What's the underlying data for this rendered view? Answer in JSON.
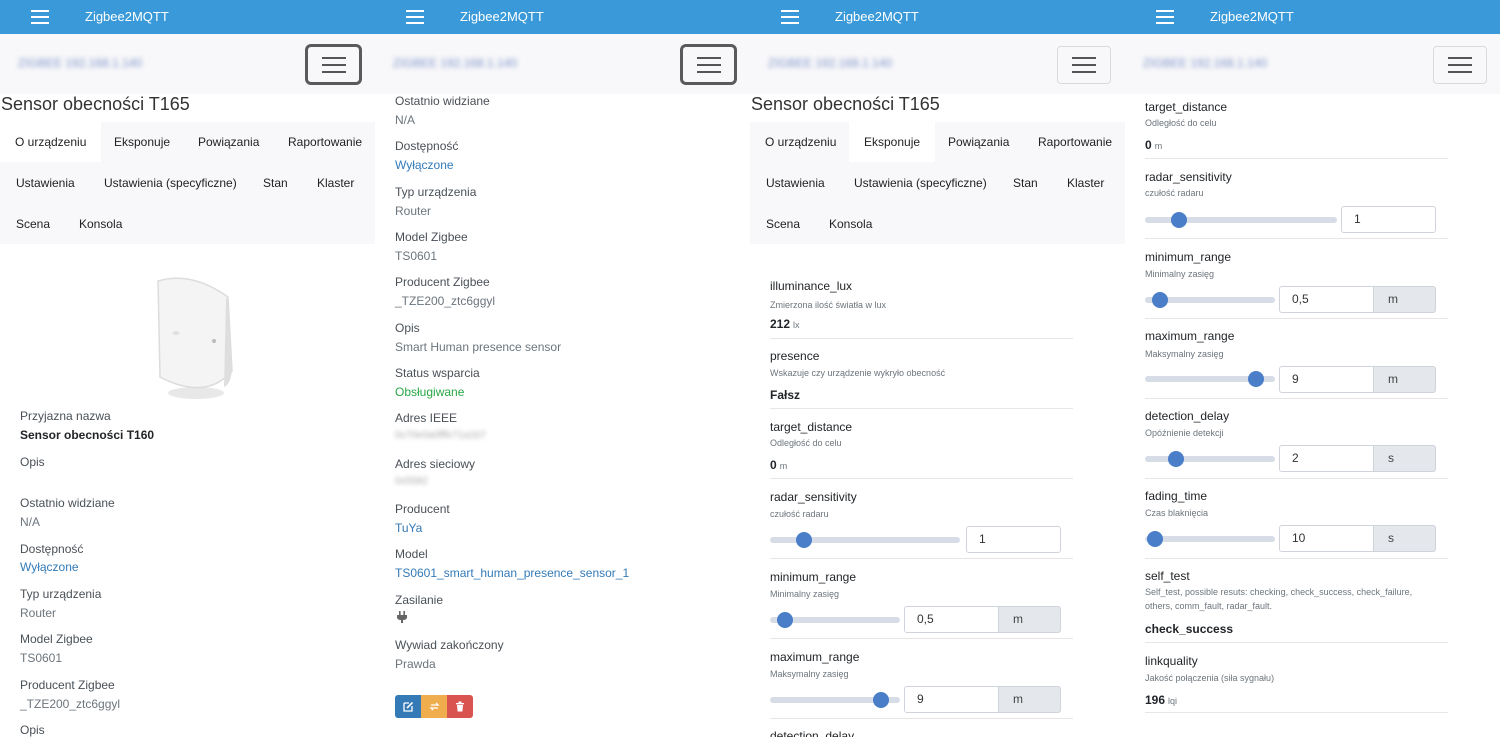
{
  "app": {
    "title": "Zigbee2MQTT",
    "host": "ZIGBEE 192.168.1.140"
  },
  "device": {
    "title": "Sensor obecności T165"
  },
  "tabs": [
    "O urządzeniu",
    "Eksponuje",
    "Powiązania",
    "Raportowanie",
    "Ustawienia",
    "Ustawienia (specyficzne)",
    "Stan",
    "Klaster",
    "Scena",
    "Konsola"
  ],
  "about_p1": {
    "friendly_name_label": "Przyjazna nazwa",
    "friendly_name": "Sensor obecności T160",
    "desc_label": "Opis",
    "last_seen_label": "Ostatnio widziane",
    "last_seen": "N/A",
    "availability_label": "Dostępność",
    "availability": "Wyłączone",
    "type_label": "Typ urządzenia",
    "type": "Router",
    "model_label": "Model Zigbee",
    "model": "TS0601",
    "manufacturer_label": "Producent Zigbee",
    "manufacturer": "_TZE200_ztc6ggyl",
    "desc2_label": "Opis"
  },
  "about_p2": {
    "last_seen_label": "Ostatnio widziane",
    "last_seen": "N/A",
    "availability_label": "Dostępność",
    "availability": "Wyłączone",
    "type_label": "Typ urządzenia",
    "type": "Router",
    "model_label": "Model Zigbee",
    "model": "TS0601",
    "zb_manufacturer_label": "Producent Zigbee",
    "zb_manufacturer": "_TZE200_ztc6ggyl",
    "desc_label": "Opis",
    "desc": "Smart Human presence sensor",
    "support_label": "Status wsparcia",
    "support": "Obsługiwane",
    "ieee_label": "Adres IEEE",
    "ieee": "0x70e0a0fffe71a1b7",
    "net_label": "Adres sieciowy",
    "net": "0x5582",
    "manufacturer_label": "Producent",
    "manufacturer": "TuYa",
    "model2_label": "Model",
    "model2": "TS0601_smart_human_presence_sensor_1",
    "power_label": "Zasilanie",
    "interview_label": "Wywiad zakończony",
    "interview": "Prawda"
  },
  "exposes": {
    "illuminance": {
      "name": "illuminance_lux",
      "desc": "Zmierzona ilość światła w lux",
      "value": "212",
      "unit": "lx"
    },
    "presence": {
      "name": "presence",
      "desc": "Wskazuje czy urządzenie wykryło obecność",
      "value": "Fałsz"
    },
    "target_distance": {
      "name": "target_distance",
      "desc": "Odległość do celu",
      "value": "0",
      "unit": "m"
    },
    "radar_sensitivity": {
      "name": "radar_sensitivity",
      "desc": "czułość radaru",
      "value": "1",
      "level": 0.15
    },
    "minimum_range": {
      "name": "minimum_range",
      "desc": "Minimalny zasięg",
      "value": "0,5",
      "unit": "m",
      "level": 0.06
    },
    "maximum_range": {
      "name": "maximum_range",
      "desc": "Maksymalny zasięg",
      "value": "9",
      "unit": "m",
      "level": 0.9
    },
    "detection_delay": {
      "name": "detection_delay",
      "desc": "Opóźnienie detekcji",
      "value": "2",
      "unit": "s",
      "level": 0.2
    },
    "fading_time": {
      "name": "fading_time",
      "desc": "Czas blaknięcia",
      "value": "10",
      "unit": "s",
      "level": 0.02
    },
    "self_test": {
      "name": "self_test",
      "desc": "Self_test, possible resuts: checking, check_success, check_failure, others, comm_fault, radar_fault.",
      "value": "check_success"
    },
    "linkquality": {
      "name": "linkquality",
      "desc": "Jakość połączenia (siła sygnału)",
      "value": "196",
      "unit": "lqi"
    }
  },
  "icons": {
    "power": "plug-icon",
    "edit": "edit-icon",
    "rename": "refresh-icon",
    "delete": "trash-icon"
  },
  "colors": {
    "topbar": "#3a9ad9",
    "link": "#337ab7",
    "supported": "#28a745"
  }
}
